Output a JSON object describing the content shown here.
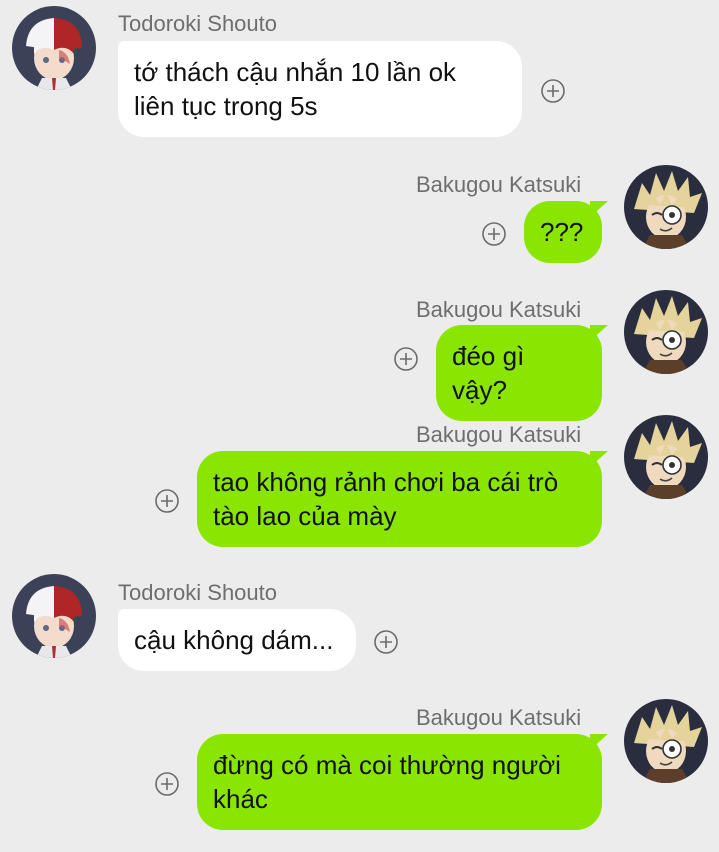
{
  "colors": {
    "background": "#ececec",
    "incoming_bubble": "#ffffff",
    "outgoing_bubble": "#8ae600",
    "sender_name": "#6e6e6e"
  },
  "icons": {
    "react": "plus-circle-icon"
  },
  "messages": [
    {
      "sender": "Todoroki Shouto",
      "text": "tớ thách cậu nhắn 10 lần ok\nliên tục trong 5s",
      "direction": "incoming"
    },
    {
      "sender": "Bakugou Katsuki",
      "text": "???",
      "direction": "outgoing"
    },
    {
      "sender": "Bakugou Katsuki",
      "text": "đéo gì vậy?",
      "direction": "outgoing"
    },
    {
      "sender": "Bakugou Katsuki",
      "text": "tao không rảnh chơi ba cái trò\ntào lao của mày",
      "direction": "outgoing"
    },
    {
      "sender": "Todoroki Shouto",
      "text": "cậu không dám...",
      "direction": "incoming"
    },
    {
      "sender": "Bakugou Katsuki",
      "text": "đừng có mà coi thường người\nkhác",
      "direction": "outgoing"
    }
  ]
}
